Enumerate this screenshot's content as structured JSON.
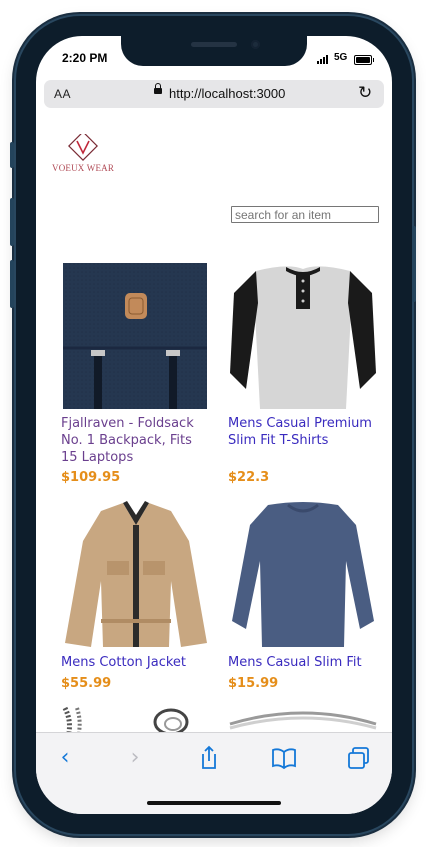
{
  "status": {
    "time": "2:20 PM",
    "network": "5G"
  },
  "browser": {
    "text_size_label": "AA",
    "url": "http://localhost:3000"
  },
  "brand": {
    "name": "VOEUX WEAR",
    "color": "#b04a55"
  },
  "search": {
    "placeholder": "search for an item",
    "value": ""
  },
  "products": [
    {
      "title": "Fjallraven - Foldsack No. 1 Backpack, Fits 15 Laptops",
      "price": "$109.95",
      "visited": true,
      "image": "backpack"
    },
    {
      "title": "Mens Casual Premium Slim Fit T-Shirts",
      "price": "$22.3",
      "visited": false,
      "image": "raglan-shirt"
    },
    {
      "title": "Mens Cotton Jacket",
      "price": "$55.99",
      "visited": false,
      "image": "jacket"
    },
    {
      "title": "Mens Casual Slim Fit",
      "price": "$15.99",
      "visited": false,
      "image": "long-sleeve-shirt"
    }
  ],
  "toolbar": {
    "back": "back-icon",
    "forward": "forward-icon",
    "share": "share-icon",
    "bookmarks": "bookmarks-icon",
    "tabs": "tabs-icon"
  },
  "colors": {
    "link": "#3a2bbf",
    "visited_link": "#6a3f8e",
    "price": "#e58e1a",
    "accent": "#1478d8"
  }
}
